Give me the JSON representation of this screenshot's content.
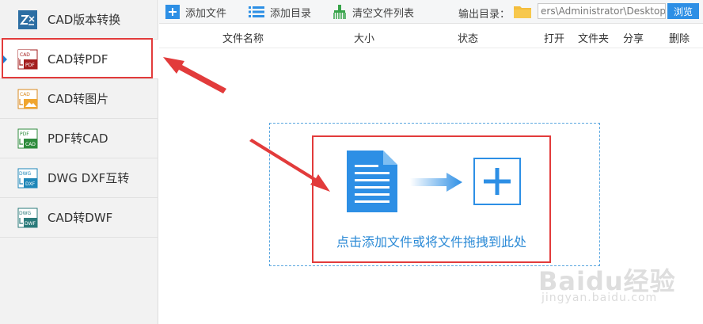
{
  "sidebar": {
    "items": [
      {
        "label": "CAD版本转换",
        "icon": "cad-version-icon"
      },
      {
        "label": "CAD转PDF",
        "icon": "cad-to-pdf-icon"
      },
      {
        "label": "CAD转图片",
        "icon": "cad-to-image-icon"
      },
      {
        "label": "PDF转CAD",
        "icon": "pdf-to-cad-icon"
      },
      {
        "label": "DWG DXF互转",
        "icon": "dwg-dxf-icon"
      },
      {
        "label": "CAD转DWF",
        "icon": "cad-to-dwf-icon"
      }
    ],
    "active_index": 1
  },
  "toolbar": {
    "add_file": "添加文件",
    "add_dir": "添加目录",
    "clear_list": "清空文件列表",
    "output_label": "输出目录：",
    "output_path": "ers\\Administrator\\Desktop",
    "browse": "浏览"
  },
  "columns": {
    "name": "文件名称",
    "size": "大小",
    "status": "状态",
    "open": "打开",
    "folder": "文件夹",
    "share": "分享",
    "delete": "删除"
  },
  "dropzone": {
    "text": "点击添加文件或将文件拖拽到此处"
  },
  "watermark": {
    "line1": "Baidu经验",
    "line2": "jingyan.baidu.com"
  },
  "colors": {
    "accent": "#2d8fe5",
    "annotation_red": "#e23b3b",
    "sidebar_bg": "#f2f2f2"
  }
}
